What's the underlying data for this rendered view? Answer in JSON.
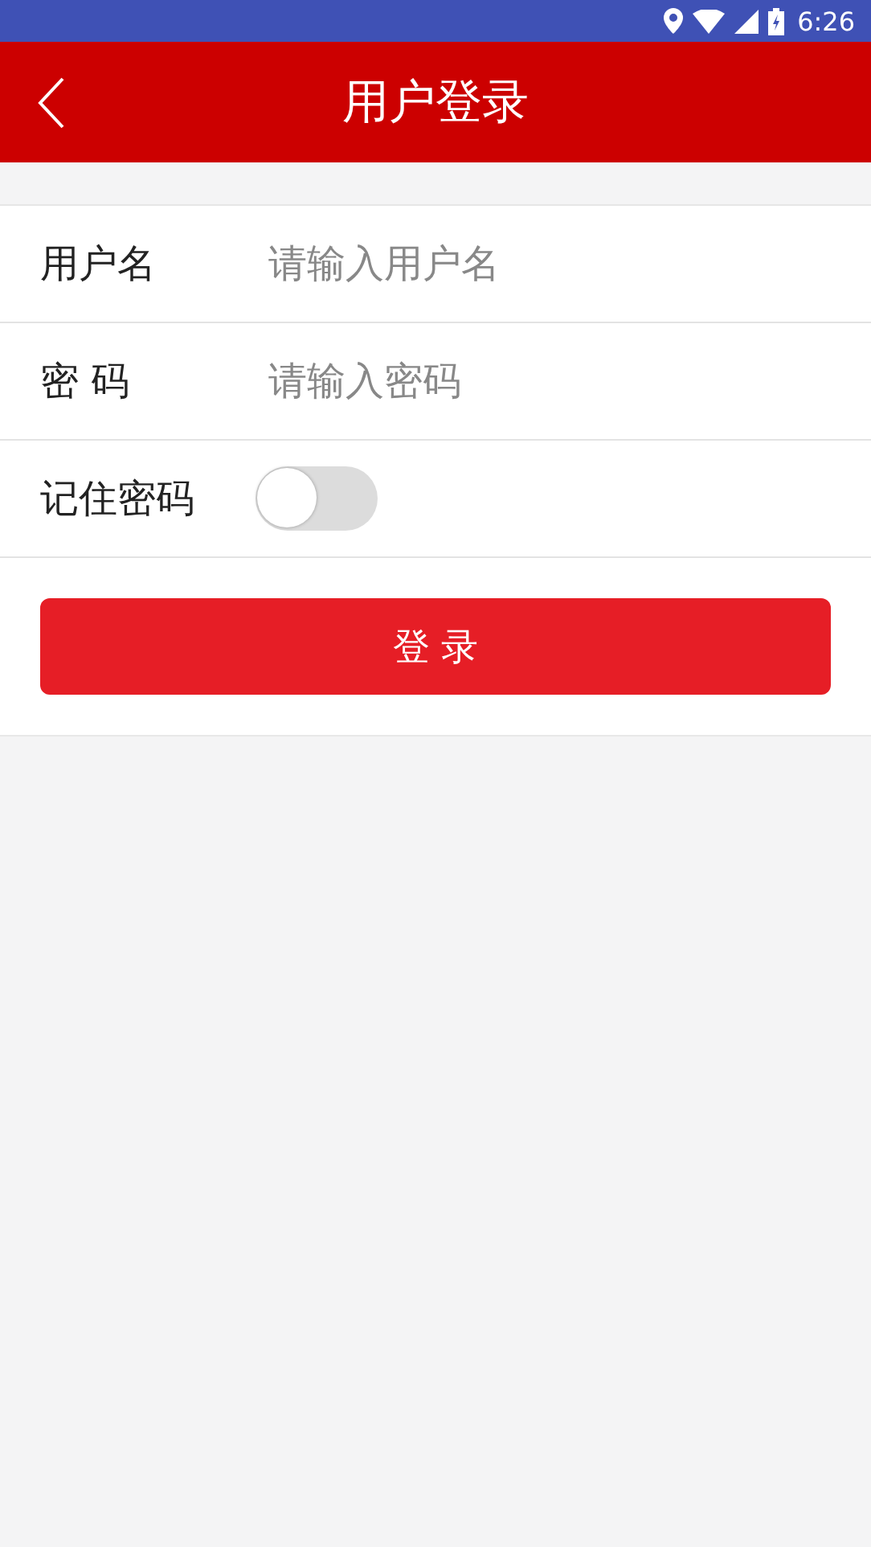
{
  "status_bar": {
    "time": "6:26"
  },
  "header": {
    "title": "用户登录"
  },
  "form": {
    "rows": [
      {
        "kind": "input",
        "label": "用户名",
        "placeholder": "请输入用户名"
      },
      {
        "kind": "input",
        "label": "密 码",
        "placeholder": "请输入密码"
      },
      {
        "kind": "toggle",
        "label": "记住密码",
        "on": false
      }
    ]
  },
  "login_button": "登 录"
}
